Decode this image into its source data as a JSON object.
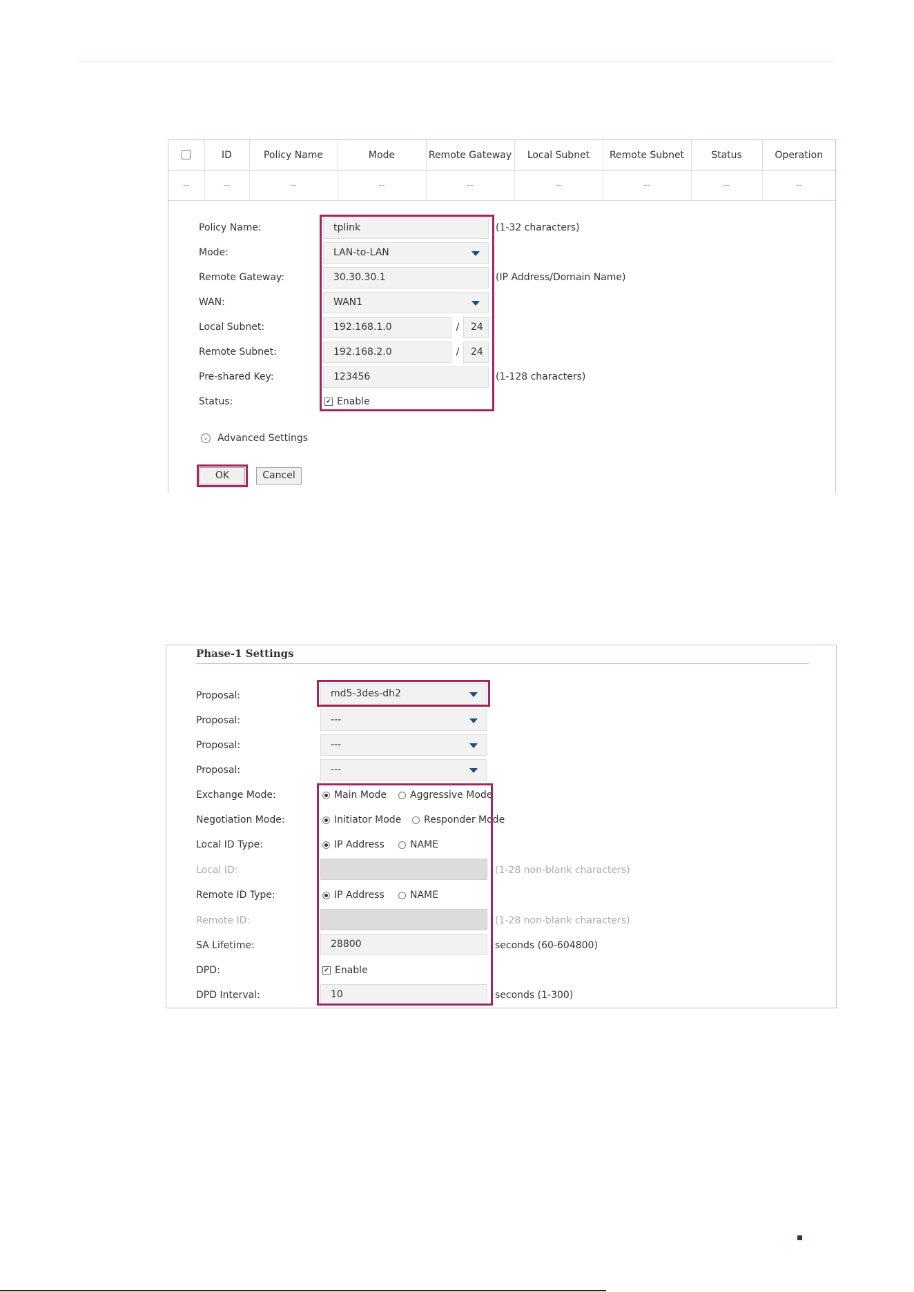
{
  "table": {
    "headers": [
      "ID",
      "Policy Name",
      "Mode",
      "Remote Gateway",
      "Local Subnet",
      "Remote Subnet",
      "Status",
      "Operation"
    ],
    "row": [
      "--",
      "--",
      "--",
      "--",
      "--",
      "--",
      "--",
      "--",
      "--"
    ]
  },
  "form": {
    "policy_name": {
      "label": "Policy Name:",
      "value": "tplink",
      "hint": "(1-32 characters)"
    },
    "mode": {
      "label": "Mode:",
      "value": "LAN-to-LAN"
    },
    "remote_gateway": {
      "label": "Remote Gateway:",
      "value": "30.30.30.1",
      "hint": "(IP Address/Domain Name)"
    },
    "wan": {
      "label": "WAN:",
      "value": "WAN1"
    },
    "local_subnet": {
      "label": "Local Subnet:",
      "value": "192.168.1.0",
      "mask": "24"
    },
    "remote_subnet": {
      "label": "Remote Subnet:",
      "value": "192.168.2.0",
      "mask": "24"
    },
    "slash": "/",
    "psk": {
      "label": "Pre-shared Key:",
      "value": "123456",
      "hint": "(1-128 characters)"
    },
    "status": {
      "label": "Status:",
      "option": "Enable",
      "checked": true
    },
    "advanced": "Advanced Settings",
    "ok": "OK",
    "cancel": "Cancel"
  },
  "phase1": {
    "title": "Phase-1 Settings",
    "proposal_label": "Proposal:",
    "proposals": [
      "md5-3des-dh2",
      "---",
      "---",
      "---"
    ],
    "exchange": {
      "label": "Exchange Mode:",
      "options": [
        "Main Mode",
        "Aggressive Mode"
      ],
      "selected": "Main Mode"
    },
    "negotiation": {
      "label": "Negotiation Mode:",
      "options": [
        "Initiator Mode",
        "Responder Mode"
      ],
      "selected": "Initiator Mode"
    },
    "local_id_type": {
      "label": "Local ID Type:",
      "options": [
        "IP Address",
        "NAME"
      ],
      "selected": "IP Address"
    },
    "local_id": {
      "label": "Local ID:",
      "value": "",
      "hint": "(1-28 non-blank characters)"
    },
    "remote_id_type": {
      "label": "Remote ID Type:",
      "options": [
        "IP Address",
        "NAME"
      ],
      "selected": "IP Address"
    },
    "remote_id": {
      "label": "Remote ID:",
      "value": "",
      "hint": "(1-28 non-blank characters)"
    },
    "sa_lifetime": {
      "label": "SA Lifetime:",
      "value": "28800",
      "hint": "seconds (60-604800)"
    },
    "dpd": {
      "label": "DPD:",
      "option": "Enable",
      "checked": true
    },
    "dpd_interval": {
      "label": "DPD Interval:",
      "value": "10",
      "hint": "seconds (1-300)"
    }
  },
  "colors": {
    "highlight": "#a3245f",
    "arrow": "#1f4e79",
    "border": "#b9c6d0"
  }
}
